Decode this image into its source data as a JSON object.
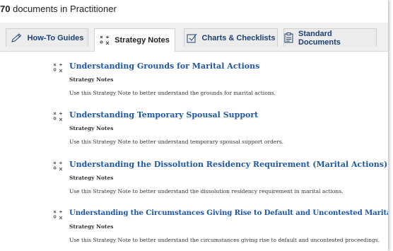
{
  "header": {
    "count": "70",
    "count_suffix": "documents in Practitioner"
  },
  "tabs": [
    {
      "label": "How-To Guides",
      "icon": "pencil-icon",
      "active": false
    },
    {
      "label": "Strategy Notes",
      "icon": "strategy-icon",
      "active": true
    },
    {
      "label": "Charts & Checklists",
      "icon": "checklist-icon",
      "active": false
    },
    {
      "label": "Standard Documents",
      "icon": "clipboard-icon",
      "active": false
    }
  ],
  "documents": [
    {
      "title": "Understanding Grounds for Marital Actions",
      "type": "Strategy Notes",
      "description": "Use this Strategy Note to better understand the grounds for marital actions."
    },
    {
      "title": "Understanding Temporary Spousal Support",
      "type": "Strategy Notes",
      "description": "Use this Strategy Note to better understand temporary spousal support orders."
    },
    {
      "title": "Understanding the Dissolution Residency Requirement (Marital Actions)",
      "type": "Strategy Notes",
      "description": "Use this Strategy Note to better understand the dissolution residency requirement in marital actions."
    },
    {
      "title": "Understanding the Circumstances Giving Rise to Default and Uncontested Marital Proceedings",
      "type": "Strategy Notes",
      "description": "Use this Strategy Note to better understand the circumstances giving rise to default and uncontested proceedings."
    }
  ],
  "colors": {
    "link": "#1f57a6",
    "tab_text": "#1c3f73",
    "tab_bg": "#ececec"
  }
}
